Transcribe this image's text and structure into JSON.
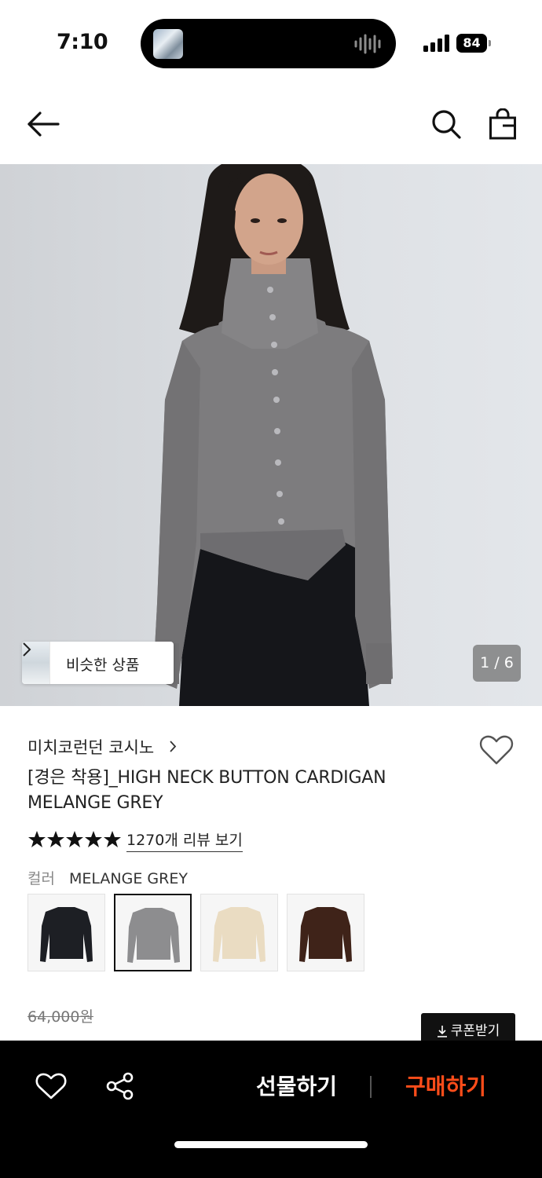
{
  "status": {
    "time": "7:10",
    "battery": "84"
  },
  "icons": {
    "back": "arrow-left-icon",
    "search": "search-icon",
    "bag": "shopping-bag-icon",
    "wishlist": "heart-outline-icon",
    "share": "share-icon",
    "coupon": "download-arrow-icon"
  },
  "hero": {
    "similar_label": "비슷한 상품",
    "counter": "1 / 6"
  },
  "product": {
    "brand": "미치코런던 코시노",
    "title": "[경은 착용]_HIGH NECK BUTTON CARDIGAN MELANGE GREY",
    "rating_stars": 5,
    "review_link": "1270개 리뷰 보기",
    "color_label": "컬러",
    "color_value": "MELANGE GREY",
    "swatches": [
      {
        "color": "#1d1f24",
        "selected": false
      },
      {
        "color": "#8d8d8f",
        "selected": true
      },
      {
        "color": "#eadcc2",
        "selected": false
      },
      {
        "color": "#3f2319",
        "selected": false
      }
    ],
    "original_price": "64,000원",
    "coupon_label": "쿠폰받기"
  },
  "bottom_bar": {
    "gift_label": "선물하기",
    "buy_label": "구매하기",
    "buy_color": "#ff4d1a"
  }
}
